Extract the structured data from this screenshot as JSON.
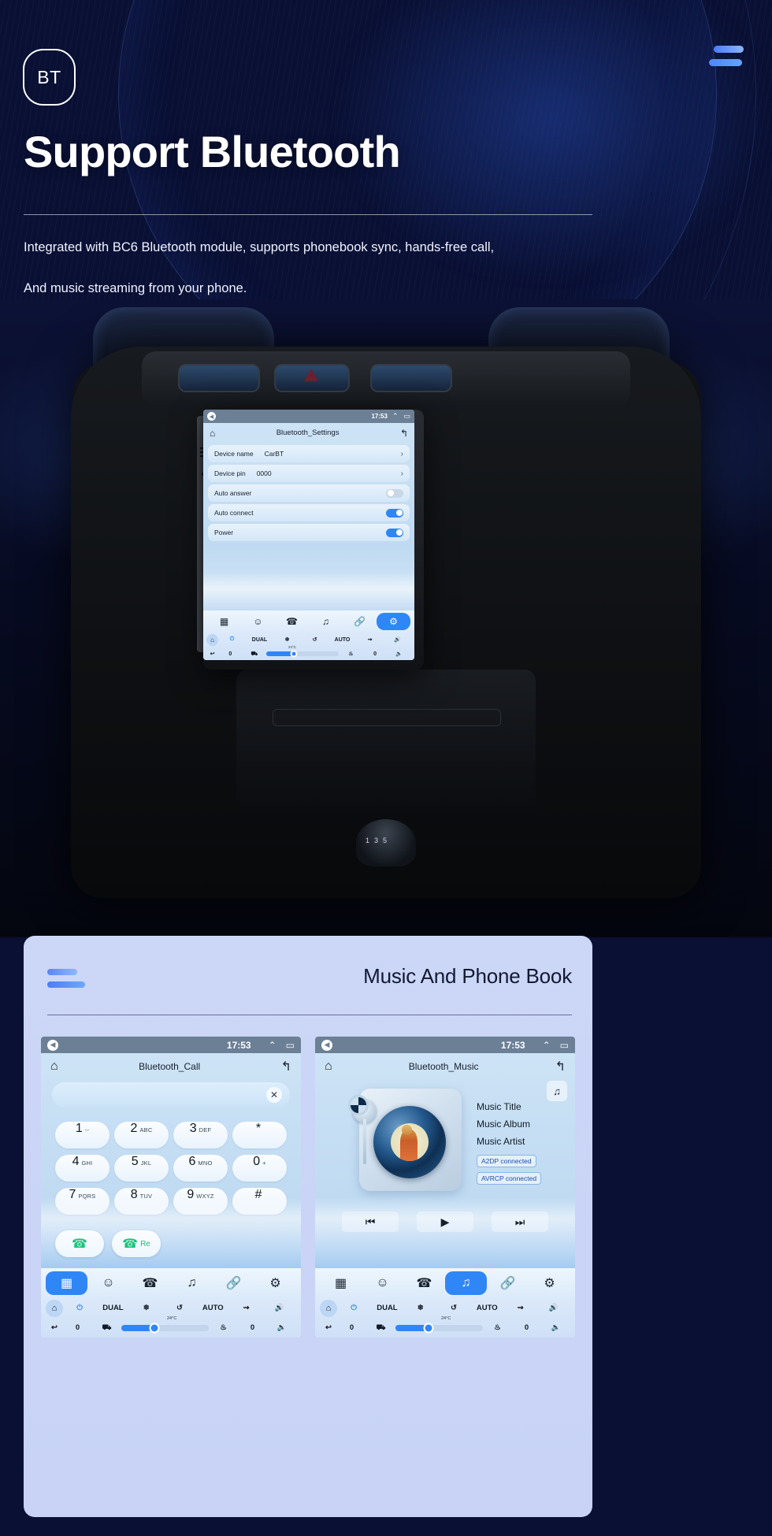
{
  "hero": {
    "badge": "BT",
    "title": "Support Bluetooth",
    "sub_line1": "Integrated with BC6 Bluetooth module, supports phonebook sync, hands-free call,",
    "sub_line2": "And music streaming from your phone.",
    "menu_icon": "hamburger-icon",
    "accent": "#4b7bff"
  },
  "main_unit": {
    "status": {
      "back_icon": "back-arrow-icon",
      "time": "17:53",
      "up_icon": "chevron-up-icon",
      "windows_icon": "recent-apps-icon"
    },
    "titlebar": {
      "home_icon": "home-icon",
      "title": "Bluetooth_Settings",
      "back_icon": "undo-arrow-icon"
    },
    "rows": [
      {
        "label": "Device name",
        "value": "CarBT",
        "control": "chevron",
        "chevron": "›"
      },
      {
        "label": "Device pin",
        "value": "0000",
        "control": "chevron",
        "chevron": "›"
      },
      {
        "label": "Auto answer",
        "value": "",
        "control": "toggle",
        "on": false
      },
      {
        "label": "Auto connect",
        "value": "",
        "control": "toggle",
        "on": true
      },
      {
        "label": "Power",
        "value": "",
        "control": "toggle",
        "on": true
      }
    ],
    "toolbar": [
      {
        "name": "apps-grid-icon",
        "active": false
      },
      {
        "name": "contacts-icon",
        "active": false
      },
      {
        "name": "phone-icon",
        "active": false
      },
      {
        "name": "music-note-icon",
        "active": false
      },
      {
        "name": "link-icon",
        "active": false
      },
      {
        "name": "settings-gear-icon",
        "active": true
      }
    ],
    "hvac": {
      "home_icon": "home-icon",
      "power_icon": "power-icon",
      "dual": "DUAL",
      "snow_icon": "snowflake-icon",
      "recirc_icon": "air-recirculation-icon",
      "auto": "AUTO",
      "defrost_icon": "defrost-icon",
      "vol_up_icon": "volume-up-icon",
      "back_icon": "back-arrow-icon",
      "left_temp": "0",
      "right_temp": "0",
      "seat_icon": "seat-icon",
      "heated_seat_icon": "heated-seat-icon",
      "vol_down_icon": "volume-down-icon",
      "temp_label": "24°C",
      "fan_percent": 38
    }
  },
  "panel": {
    "title": "Music And Phone Book",
    "bars_icon": "stacked-bars-icon"
  },
  "call_unit": {
    "status": {
      "back_icon": "back-arrow-icon",
      "time": "17:53",
      "up_icon": "chevron-up-icon",
      "windows_icon": "recent-apps-icon"
    },
    "titlebar": {
      "home_icon": "home-icon",
      "title": "Bluetooth_Call",
      "back_icon": "undo-arrow-icon"
    },
    "search": {
      "value": "",
      "placeholder": "",
      "clear_icon": "close-x-icon"
    },
    "keys": [
      {
        "digit": "1",
        "sub": "--"
      },
      {
        "digit": "2",
        "sub": "ABC"
      },
      {
        "digit": "3",
        "sub": "DEF"
      },
      {
        "digit": "*",
        "sub": ""
      },
      {
        "digit": "4",
        "sub": "GHI"
      },
      {
        "digit": "5",
        "sub": "JKL"
      },
      {
        "digit": "6",
        "sub": "MNO"
      },
      {
        "digit": "0",
        "sub": "+"
      },
      {
        "digit": "7",
        "sub": "PQRS"
      },
      {
        "digit": "8",
        "sub": "TUV"
      },
      {
        "digit": "9",
        "sub": "WXYZ"
      },
      {
        "digit": "#",
        "sub": ""
      }
    ],
    "call_button": {
      "icon": "phone-call-icon",
      "label": ""
    },
    "redial_button": {
      "icon": "phone-call-icon",
      "label": "Re"
    },
    "toolbar": [
      {
        "name": "apps-grid-icon",
        "active": true
      },
      {
        "name": "contacts-icon",
        "active": false
      },
      {
        "name": "phone-icon",
        "active": false
      },
      {
        "name": "music-note-icon",
        "active": false
      },
      {
        "name": "link-icon",
        "active": false
      },
      {
        "name": "settings-gear-icon",
        "active": false
      }
    ],
    "hvac": {
      "dual": "DUAL",
      "auto": "AUTO",
      "temp_label": "24°C",
      "left_temp": "0",
      "right_temp": "0",
      "fan_percent": 38
    }
  },
  "music_unit": {
    "status": {
      "back_icon": "back-arrow-icon",
      "time": "17:53",
      "up_icon": "chevron-up-icon",
      "windows_icon": "recent-apps-icon"
    },
    "titlebar": {
      "home_icon": "home-icon",
      "title": "Bluetooth_Music",
      "back_icon": "undo-arrow-icon"
    },
    "fab_icon": "music-note-icon",
    "info": {
      "title": "Music Title",
      "album": "Music Album",
      "artist": "Music Artist"
    },
    "badges": [
      "A2DP  connected",
      "AVRCP connected"
    ],
    "controls": [
      {
        "name": "previous-track-button",
        "glyph": "⏮"
      },
      {
        "name": "play-button",
        "glyph": "▶"
      },
      {
        "name": "next-track-button",
        "glyph": "⏭"
      }
    ],
    "toolbar": [
      {
        "name": "apps-grid-icon",
        "active": false
      },
      {
        "name": "contacts-icon",
        "active": false
      },
      {
        "name": "phone-icon",
        "active": false
      },
      {
        "name": "music-note-icon",
        "active": true
      },
      {
        "name": "link-icon",
        "active": false
      },
      {
        "name": "settings-gear-icon",
        "active": false
      }
    ],
    "hvac": {
      "dual": "DUAL",
      "auto": "AUTO",
      "temp_label": "24°C",
      "left_temp": "0",
      "right_temp": "0",
      "fan_percent": 38
    }
  }
}
